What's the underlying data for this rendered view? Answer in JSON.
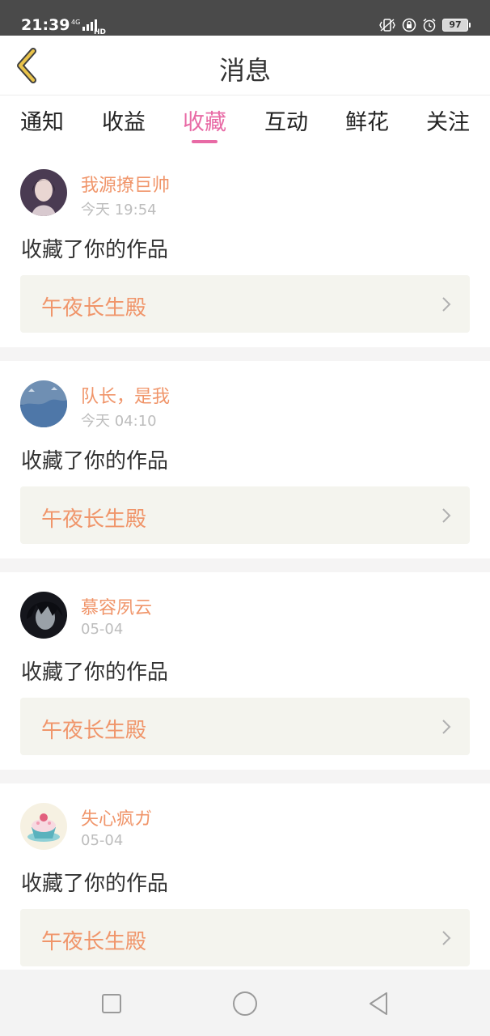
{
  "status_bar": {
    "time": "21:39",
    "network": "4G",
    "network_badge": "HD",
    "battery": "97",
    "icons": [
      "vibrate-icon",
      "lock-icon",
      "alarm-icon"
    ]
  },
  "header": {
    "title": "消息",
    "back_icon": "chevron-left-icon",
    "accent_color": "#e86aa5",
    "back_color": "#e9c34a"
  },
  "tabs": [
    {
      "label": "通知",
      "active": false
    },
    {
      "label": "收益",
      "active": false
    },
    {
      "label": "收藏",
      "active": true
    },
    {
      "label": "互动",
      "active": false
    },
    {
      "label": "鲜花",
      "active": false
    },
    {
      "label": "关注",
      "active": false
    }
  ],
  "messages": [
    {
      "username": "我源撩巨帅",
      "time": "今天 19:54",
      "action": "收藏了你的作品",
      "work_title": "午夜长生殿"
    },
    {
      "username": "队长，是我",
      "time": "今天 04:10",
      "action": "收藏了你的作品",
      "work_title": "午夜长生殿"
    },
    {
      "username": "慕容夙云",
      "time": "05-04",
      "action": "收藏了你的作品",
      "work_title": "午夜长生殿"
    },
    {
      "username": "失心疯ガ",
      "time": "05-04",
      "action": "收藏了你的作品",
      "work_title": "午夜长生殿"
    }
  ],
  "colors": {
    "username": "#f0956a",
    "work_title": "#f0956a",
    "work_bg": "#f4f4ee",
    "time": "#bdbdbd",
    "status_bar_bg": "#4a4a4a"
  },
  "nav_bar": {
    "buttons": [
      "square-recents-icon",
      "circle-home-icon",
      "triangle-back-icon"
    ]
  }
}
